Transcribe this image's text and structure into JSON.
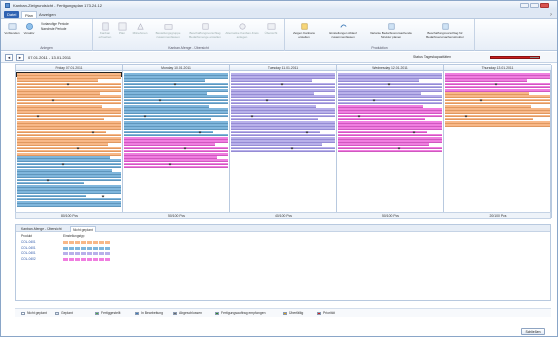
{
  "window": {
    "title": "Kanban-Zielgrundsicht - Fertigungsplan 173.24.12"
  },
  "menu": {
    "file": "Datei",
    "tabs": [
      "Plan",
      "Anzeigen"
    ],
    "help": "?"
  },
  "ribbon": {
    "groups": [
      {
        "label": "Anlegen",
        "buttons": [
          "Vorblenden",
          "Voraktiv"
        ],
        "small": [
          "Vorlaeufige Periode",
          "Naechste Periode"
        ]
      },
      {
        "label": "Kanban-Menge - Übersicht",
        "buttons": [
          "Kanban erhoehen",
          "Plan",
          "Mitnehmen",
          "Bestellungsgruppe zusammenfassen",
          "Beschaffungsvorschlag Bedarfsmenge erstellen",
          "Alternative Kanban-Kreis anlegen",
          "Übersicht"
        ]
      },
      {
        "label": "Produktion",
        "buttons": [
          "Zeigen Kanbans erstellen",
          "Einstellungen Ablauf zusammenfassen",
          "Variante Bedarfsverursachende Struktur planen",
          "Beschaffungsvorschlag für Bedarfsverursachersstruktur"
        ]
      }
    ]
  },
  "datebar": {
    "prev": "◄",
    "next": "►",
    "range": "07.01.2011 - 13.01.2011",
    "status_label": "Status Tageskapazitäten"
  },
  "days": [
    {
      "label": "Friday 07.01.2011",
      "total": "80/100 Pcs",
      "width_units": 107
    },
    {
      "label": "Monday 10.01.2011",
      "total": "50/100 Pcs",
      "width_units": 107
    },
    {
      "label": "Tuesday 11.01.2011",
      "total": "40/100 Pcs",
      "width_units": 107
    },
    {
      "label": "Wednesday 12.01.2011",
      "total": "50/100 Pcs",
      "width_units": 107
    },
    {
      "label": "Thursday 13.01.2011",
      "total": "20/100 Pcs",
      "width_units": 108
    }
  ],
  "bars": [
    [
      "o",
      "o",
      "o",
      "o",
      "o",
      "o",
      "o",
      "o",
      "o",
      "o",
      "o",
      "o",
      "o",
      "o",
      "o",
      "o",
      "o",
      "o",
      "o",
      "o",
      "o",
      "o",
      "o",
      "o",
      "o",
      "o",
      "b",
      "b",
      "b",
      "b",
      "b",
      "b",
      "b",
      "b",
      "b",
      "b",
      "b",
      "b",
      "b",
      "b",
      "b",
      "b"
    ],
    [
      "b",
      "b",
      "b",
      "b",
      "b",
      "b",
      "b",
      "b",
      "b",
      "b",
      "b",
      "b",
      "b",
      "b",
      "b",
      "b",
      "b",
      "b",
      "b",
      "b",
      "m",
      "m",
      "m",
      "m",
      "m",
      "m",
      "m",
      "m",
      "m",
      "m"
    ],
    [
      "p",
      "p",
      "p",
      "p",
      "p",
      "p",
      "p",
      "p",
      "p",
      "p",
      "p",
      "p",
      "p",
      "p",
      "p",
      "p",
      "p",
      "p",
      "p",
      "p",
      "p",
      "p",
      "p",
      "p",
      "p"
    ],
    [
      "p",
      "p",
      "p",
      "p",
      "p",
      "p",
      "p",
      "p",
      "p",
      "p",
      "m",
      "m",
      "m",
      "m",
      "m",
      "m",
      "m",
      "m",
      "m",
      "m",
      "m",
      "m",
      "m",
      "m",
      "m"
    ],
    [
      "m",
      "m",
      "m",
      "m",
      "m",
      "m",
      "o",
      "o",
      "o",
      "o",
      "o",
      "o",
      "o",
      "o",
      "o",
      "o",
      "o"
    ]
  ],
  "panel": {
    "tabs": [
      "Kanban-Menge - Übersicht",
      "Nicht geplant"
    ],
    "columns": [
      "Produkt",
      "Einstellungstyp"
    ],
    "rows": [
      {
        "name": "COL-0401",
        "color": "o"
      },
      {
        "name": "COL-0401",
        "color": "b"
      },
      {
        "name": "COL-0401",
        "color": "p"
      },
      {
        "name": "COL-0402",
        "color": "m"
      }
    ]
  },
  "legend": [
    "Nicht geplant",
    "Geplant",
    "Fertiggestellt",
    "In Bearbeitung",
    "Abgeschlossen",
    "Fertigungsauftrag empfangen",
    "Überfällig",
    "Priorität"
  ],
  "footer": {
    "close": "Schließen"
  }
}
